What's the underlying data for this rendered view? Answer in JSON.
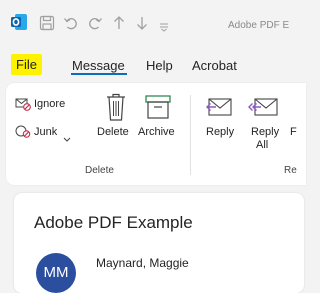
{
  "window": {
    "title": "Adobe PDF E",
    "app_icon": "outlook-icon",
    "accent": "#0f6cbd"
  },
  "menubar": {
    "items": [
      {
        "label": "File",
        "highlight": "#fff200"
      },
      {
        "label": "Message",
        "selected": true
      },
      {
        "label": "Help"
      },
      {
        "label": "Acrobat"
      }
    ]
  },
  "ribbon": {
    "ignore_label": "Ignore",
    "junk_label": "Junk",
    "delete_label": "Delete",
    "archive_label": "Archive",
    "group_delete": "Delete",
    "reply_label": "Reply",
    "reply_all_line1": "Reply",
    "reply_all_line2": "All",
    "forward_partial": "F",
    "group_respond_partial": "Re"
  },
  "message": {
    "subject": "Adobe PDF Example",
    "avatar_initials": "MM",
    "avatar_color": "#2b4f9e",
    "sender": "Maynard, Maggie"
  }
}
